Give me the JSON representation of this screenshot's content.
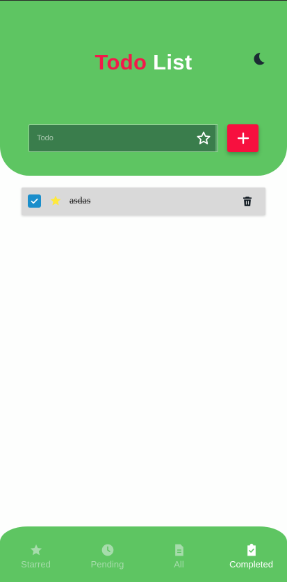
{
  "header": {
    "title_part1": "Todo",
    "title_part2": "List",
    "theme_toggle_icon": "moon-icon"
  },
  "new_todo": {
    "placeholder": "Todo",
    "star_icon": "star-outline-icon",
    "add_icon": "plus-icon"
  },
  "todos": [
    {
      "text": "asdas",
      "completed": true,
      "starred": true
    }
  ],
  "nav": {
    "items": [
      {
        "label": "Starred",
        "icon": "star-icon",
        "active": false
      },
      {
        "label": "Pending",
        "icon": "clock-icon",
        "active": false
      },
      {
        "label": "All",
        "icon": "document-icon",
        "active": false
      },
      {
        "label": "Completed",
        "icon": "clipboard-check-icon",
        "active": true
      }
    ]
  },
  "colors": {
    "primary_green": "#5ec562",
    "accent_red": "#f7103f",
    "checkbox_blue": "#1a8ecb",
    "star_yellow": "#ffe93b"
  }
}
